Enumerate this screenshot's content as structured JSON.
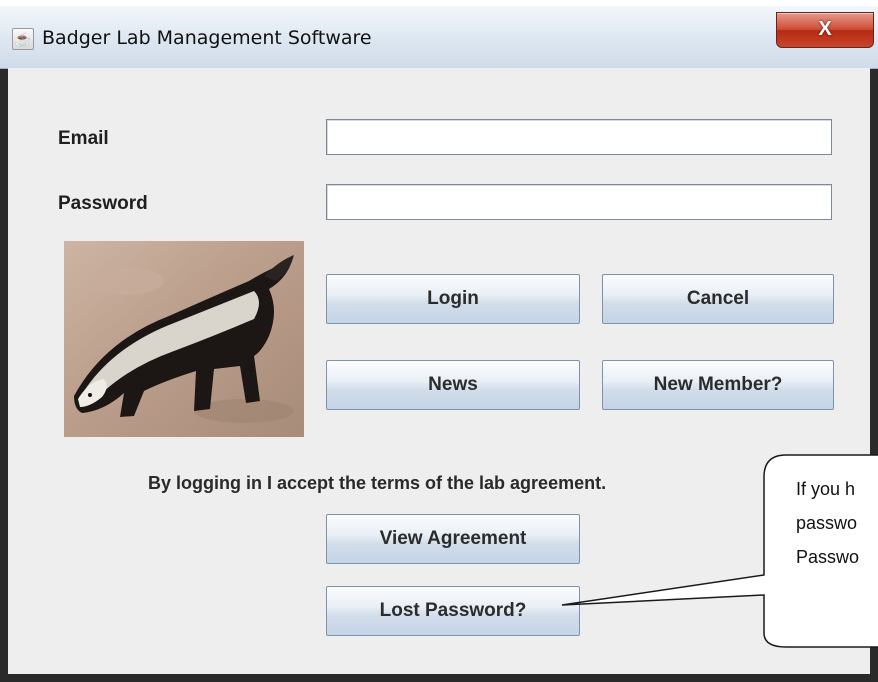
{
  "window": {
    "title": "Badger Lab Management Software",
    "close_label": "X"
  },
  "form": {
    "email_label": "Email",
    "email_value": "",
    "password_label": "Password",
    "password_value": ""
  },
  "buttons": {
    "login": "Login",
    "cancel": "Cancel",
    "news": "News",
    "new_member": "New Member?",
    "view_agreement": "View Agreement",
    "lost_password": "Lost Password?"
  },
  "notice": "By logging in I accept the terms of the lab agreement.",
  "callout": {
    "lines": [
      "If you h",
      "passwo",
      "Passwo"
    ]
  },
  "icons": {
    "app_icon": "java-cup-icon",
    "badger_image": "honey-badger-photo"
  }
}
